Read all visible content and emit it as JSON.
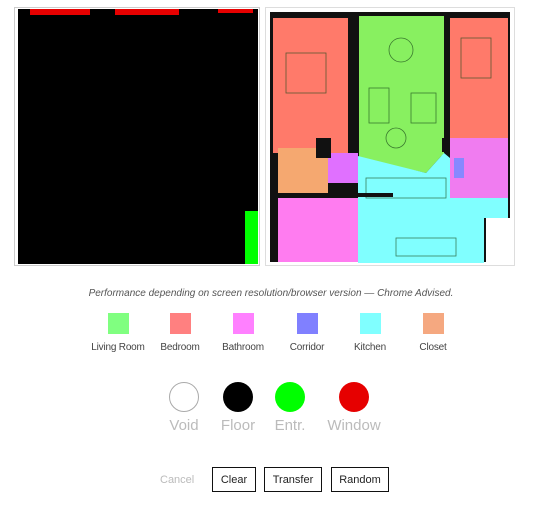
{
  "note": "Performance depending on screen resolution/browser version — Chrome Advised.",
  "room_legend": [
    {
      "label": "Living Room",
      "color": "#80ff80"
    },
    {
      "label": "Bedroom",
      "color": "#ff8080"
    },
    {
      "label": "Bathroom",
      "color": "#ff80ff"
    },
    {
      "label": "Corridor",
      "color": "#8080ff"
    },
    {
      "label": "Kitchen",
      "color": "#80ffff"
    },
    {
      "label": "Closet",
      "color": "#f5a880"
    }
  ],
  "tools": [
    {
      "label": "Void",
      "color": "#ffffff"
    },
    {
      "label": "Floor",
      "color": "#000000"
    },
    {
      "label": "Entr.",
      "color": "#00ff00"
    },
    {
      "label": "Window",
      "color": "#e60000"
    }
  ],
  "buttons": {
    "cancel": "Cancel",
    "clear": "Clear",
    "transfer": "Transfer",
    "random": "Random"
  }
}
